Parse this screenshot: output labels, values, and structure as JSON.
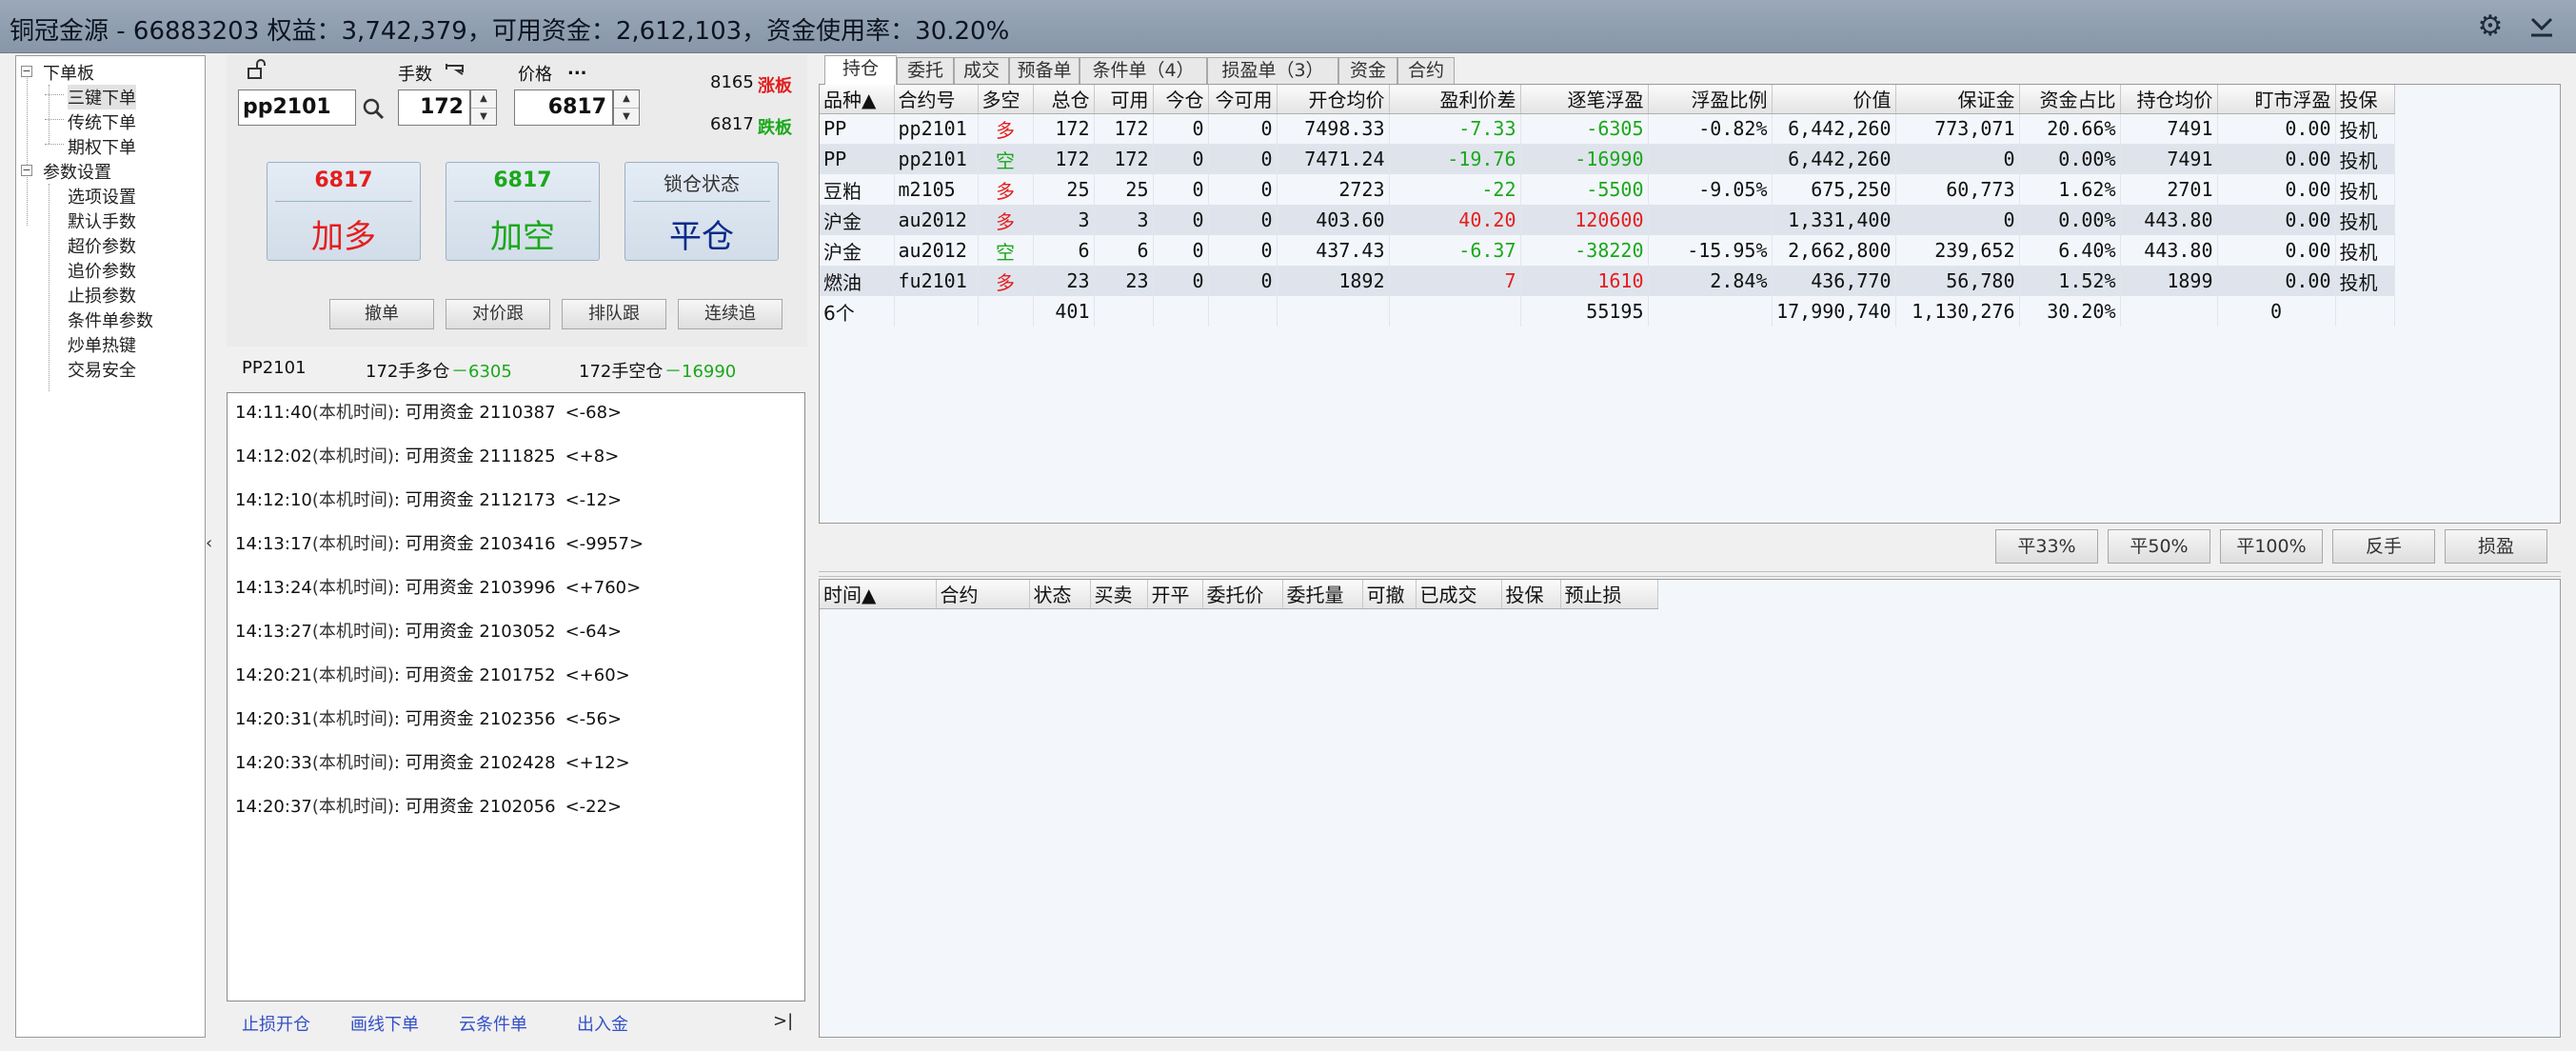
{
  "window": {
    "title": "铜冠金源 - 66883203  权益：3,742,379，可用资金：2,612,103，资金使用率：30.20%"
  },
  "colors": {
    "up": "#e41e1e",
    "down": "#1ba81b",
    "accent": "#0a2a8a"
  },
  "tree": {
    "groups": [
      {
        "label": "下单板",
        "items": [
          "三键下单",
          "传统下单",
          "期权下单"
        ]
      },
      {
        "label": "参数设置",
        "items": [
          "选项设置",
          "默认手数",
          "超价参数",
          "追价参数",
          "止损参数",
          "条件单参数",
          "炒单热键",
          "交易安全"
        ]
      }
    ],
    "selected": "三键下单"
  },
  "order_panel": {
    "lots_label": "手数",
    "price_label": "价格",
    "price_menu": "...",
    "contract_value": "pp2101",
    "lots_value": "172",
    "price_value": "6817",
    "limit_up_value": "8165",
    "limit_up_label": "涨板",
    "limit_down_value": "6817",
    "limit_down_label": "跌板",
    "btn_long_price": "6817",
    "btn_long_label": "加多",
    "btn_short_price": "6817",
    "btn_short_label": "加空",
    "btn_close_top": "锁仓状态",
    "btn_close_label": "平仓",
    "btn_cancel": "撤单",
    "btn_opp_chase": "对价跟",
    "btn_queue_chase": "排队跟",
    "btn_continue_chase": "连续追"
  },
  "summary": {
    "contract": "PP2101",
    "long_text": "172手多仓",
    "long_pnl": "－6305",
    "short_text": "172手空仓",
    "short_pnl": "－16990"
  },
  "log": [
    {
      "time": "14:11:40",
      "tag": "(本机时间)",
      "label": ": 可用资金 ",
      "value": "2110387",
      "delta": "<-68>"
    },
    {
      "time": "14:12:02",
      "tag": "(本机时间)",
      "label": ": 可用资金 ",
      "value": "2111825",
      "delta": "<+8>"
    },
    {
      "time": "14:12:10",
      "tag": "(本机时间)",
      "label": ": 可用资金 ",
      "value": "2112173",
      "delta": "<-12>"
    },
    {
      "time": "14:13:17",
      "tag": "(本机时间)",
      "label": ": 可用资金 ",
      "value": "2103416",
      "delta": "<-9957>"
    },
    {
      "time": "14:13:24",
      "tag": "(本机时间)",
      "label": ": 可用资金 ",
      "value": "2103996",
      "delta": "<+760>"
    },
    {
      "time": "14:13:27",
      "tag": "(本机时间)",
      "label": ": 可用资金 ",
      "value": "2103052",
      "delta": "<-64>"
    },
    {
      "time": "14:20:21",
      "tag": "(本机时间)",
      "label": ": 可用资金 ",
      "value": "2101752",
      "delta": "<+60>"
    },
    {
      "time": "14:20:31",
      "tag": "(本机时间)",
      "label": ": 可用资金 ",
      "value": "2102356",
      "delta": "<-56>"
    },
    {
      "time": "14:20:33",
      "tag": "(本机时间)",
      "label": ": 可用资金 ",
      "value": "2102428",
      "delta": "<+12>"
    },
    {
      "time": "14:20:37",
      "tag": "(本机时间)",
      "label": ": 可用资金 ",
      "value": "2102056",
      "delta": "<-22>"
    }
  ],
  "quick_links": [
    "止损开仓",
    "画线下单",
    "云条件单",
    "出入金"
  ],
  "quick_more": ">|",
  "tabs": [
    "持仓",
    "委托",
    "成交",
    "预备单",
    "条件单（4）",
    "损盈单（3）",
    "资金",
    "合约"
  ],
  "positions": {
    "columns": [
      "品种▲",
      "合约号",
      "多空",
      "总仓",
      "可用",
      "今仓",
      "今可用",
      "开仓均价",
      "盈利价差",
      "逐笔浮盈",
      "浮盈比例",
      "价值",
      "保证金",
      "资金占比",
      "持仓均价",
      "盯市浮盈",
      "投保"
    ],
    "rows": [
      [
        "PP",
        "pp2101",
        "多",
        "172",
        "172",
        "0",
        "0",
        "7498.33",
        "-7.33",
        "-6305",
        "-0.82%",
        "6,442,260",
        "773,071",
        "20.66%",
        "7491",
        "0.00",
        "投机"
      ],
      [
        "PP",
        "pp2101",
        "空",
        "172",
        "172",
        "0",
        "0",
        "7471.24",
        "-19.76",
        "-16990",
        "",
        "6,442,260",
        "0",
        "0.00%",
        "7491",
        "0.00",
        "投机"
      ],
      [
        "豆粕",
        "m2105",
        "多",
        "25",
        "25",
        "0",
        "0",
        "2723",
        "-22",
        "-5500",
        "-9.05%",
        "675,250",
        "60,773",
        "1.62%",
        "2701",
        "0.00",
        "投机"
      ],
      [
        "沪金",
        "au2012",
        "多",
        "3",
        "3",
        "0",
        "0",
        "403.60",
        "40.20",
        "120600",
        "",
        "1,331,400",
        "0",
        "0.00%",
        "443.80",
        "0.00",
        "投机"
      ],
      [
        "沪金",
        "au2012",
        "空",
        "6",
        "6",
        "0",
        "0",
        "437.43",
        "-6.37",
        "-38220",
        "-15.95%",
        "2,662,800",
        "239,652",
        "6.40%",
        "443.80",
        "0.00",
        "投机"
      ],
      [
        "燃油",
        "fu2101",
        "多",
        "23",
        "23",
        "0",
        "0",
        "1892",
        "7",
        "1610",
        "2.84%",
        "436,770",
        "56,780",
        "1.52%",
        "1899",
        "0.00",
        "投机"
      ]
    ],
    "total": {
      "label": "6个",
      "total_pos": "401",
      "pnl": "55195",
      "value": "17,990,740",
      "margin": "1,130,276",
      "ratio": "30.20%",
      "mtm": "0"
    }
  },
  "close_buttons": [
    "平33%",
    "平50%",
    "平100%",
    "反手",
    "损盈"
  ],
  "orders": {
    "columns": [
      "时间▲",
      "合约",
      "状态",
      "买卖",
      "开平",
      "委托价",
      "委托量",
      "可撤",
      "已成交",
      "投保",
      "预止损"
    ]
  }
}
